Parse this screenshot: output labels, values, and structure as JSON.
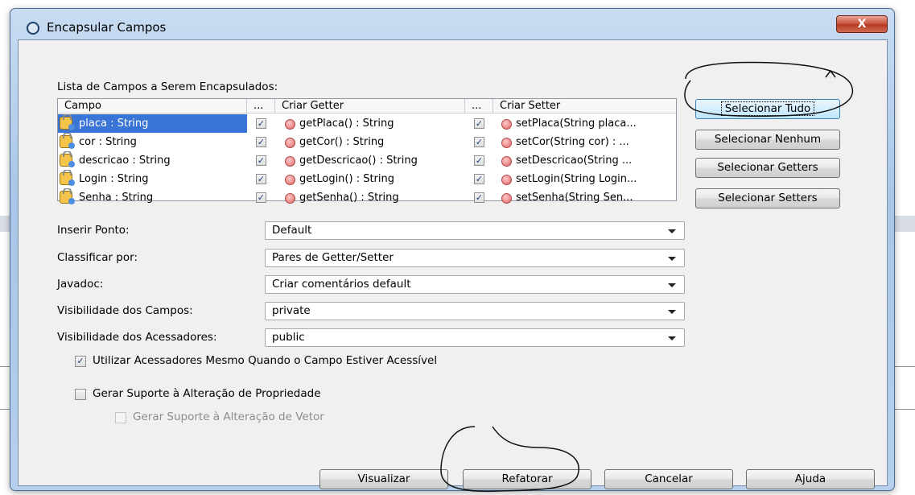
{
  "window": {
    "title": "Encapsular Campos",
    "close_label": "X"
  },
  "fields": {
    "label": "Lista de Campos a Serem Encapsulados:",
    "columns": {
      "campo": "Campo",
      "ellipsis": "...",
      "getter": "Criar Getter",
      "setter": "Criar Setter"
    },
    "rows": [
      {
        "field": "placa : String",
        "getter": "getPlaca() : String",
        "setter": "setPlaca(String placa...",
        "getter_checked": true,
        "setter_checked": true,
        "selected": true
      },
      {
        "field": "cor : String",
        "getter": "getCor() : String",
        "setter": "setCor(String cor) : ...",
        "getter_checked": true,
        "setter_checked": true,
        "selected": false
      },
      {
        "field": "descricao : String",
        "getter": "getDescricao() : String",
        "setter": "setDescricao(String ...",
        "getter_checked": true,
        "setter_checked": true,
        "selected": false
      },
      {
        "field": "Login : String",
        "getter": "getLogin() : String",
        "setter": "setLogin(String Login...",
        "getter_checked": true,
        "setter_checked": true,
        "selected": false
      },
      {
        "field": "Senha : String",
        "getter": "getSenha() : String",
        "setter": "setSenha(String Sen...",
        "getter_checked": true,
        "setter_checked": true,
        "selected": false
      }
    ]
  },
  "side_buttons": {
    "select_all": "Selecionar Tudo",
    "select_none": "Selecionar Nenhum",
    "select_getters": "Selecionar Getters",
    "select_setters": "Selecionar Setters"
  },
  "options": {
    "insert_point": {
      "label": "Inserir Ponto:",
      "value": "Default"
    },
    "sort_by": {
      "label": "Classificar por:",
      "value": "Pares de Getter/Setter"
    },
    "javadoc": {
      "label": "Javadoc:",
      "value": "Criar comentários default"
    },
    "field_visibility": {
      "label": "Visibilidade dos Campos:",
      "value": "private"
    },
    "accessor_visibility": {
      "label": "Visibilidade dos Acessadores:",
      "value": "public"
    }
  },
  "checkboxes": {
    "use_accessors": {
      "label": "Utilizar Acessadores Mesmo Quando o Campo Estiver Acessível",
      "checked": true
    },
    "property_change": {
      "label": "Gerar Suporte à Alteração de Propriedade",
      "checked": false
    },
    "vetoable_change": {
      "label": "Gerar Suporte à Alteração de Vetor",
      "checked": false,
      "disabled": true
    }
  },
  "footer": {
    "preview": "Visualizar",
    "refactor": "Refatorar",
    "cancel": "Cancelar",
    "help": "Ajuda"
  },
  "check_glyph": "✓",
  "colors": {
    "selection": "#3875d7",
    "title_bar": "#b6cfec",
    "close_button": "#c9523b"
  }
}
